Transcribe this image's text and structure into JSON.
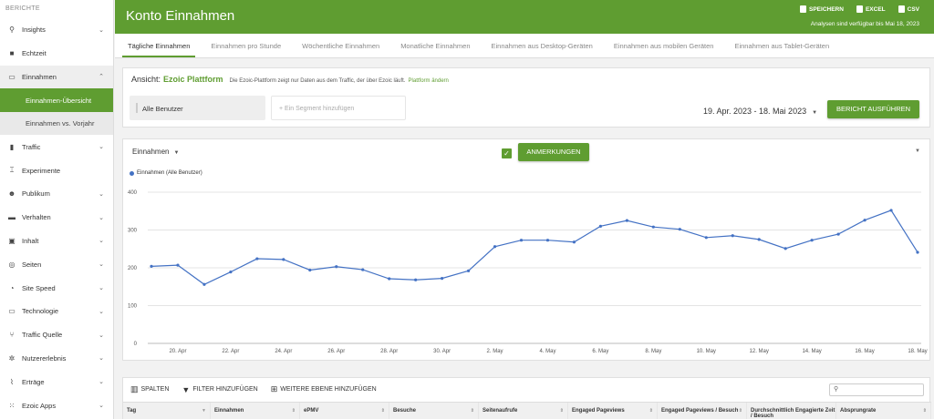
{
  "sidebar": {
    "heading": "BERICHTE",
    "items": [
      {
        "label": "Insights",
        "icon": "search-icon",
        "glyph": "⚲",
        "chevron": "⌄"
      },
      {
        "label": "Echtzeit",
        "icon": "video-icon",
        "glyph": "■",
        "chevron": ""
      },
      {
        "label": "Einnahmen",
        "icon": "money-icon",
        "glyph": "▭",
        "chevron": "⌃"
      },
      {
        "label": "Traffic",
        "icon": "traffic-icon",
        "glyph": "▮",
        "chevron": "⌄"
      },
      {
        "label": "Experimente",
        "icon": "flask-icon",
        "glyph": "⌶",
        "chevron": ""
      },
      {
        "label": "Publikum",
        "icon": "people-icon",
        "glyph": "☻",
        "chevron": "⌄"
      },
      {
        "label": "Verhalten",
        "icon": "behavior-icon",
        "glyph": "▬",
        "chevron": "⌄"
      },
      {
        "label": "Inhalt",
        "icon": "content-icon",
        "glyph": "▣",
        "chevron": "⌄"
      },
      {
        "label": "Seiten",
        "icon": "globe-icon",
        "glyph": "◎",
        "chevron": "⌄"
      },
      {
        "label": "Site Speed",
        "icon": "speedometer-icon",
        "glyph": "◔",
        "chevron": "⌄"
      },
      {
        "label": "Technologie",
        "icon": "monitor-icon",
        "glyph": "▭",
        "chevron": "⌄"
      },
      {
        "label": "Traffic Quelle",
        "icon": "source-icon",
        "glyph": "⑂",
        "chevron": "⌄"
      },
      {
        "label": "Nutzererlebnis",
        "icon": "gear-icon",
        "glyph": "✲",
        "chevron": "⌄"
      },
      {
        "label": "Erträge",
        "icon": "chart-icon",
        "glyph": "⌇",
        "chevron": "⌄"
      },
      {
        "label": "Ezoic Apps",
        "icon": "apps-icon",
        "glyph": "⁙",
        "chevron": "⌄"
      }
    ],
    "subitems": [
      {
        "label": "Einnahmen-Übersicht",
        "active": true
      },
      {
        "label": "Einnahmen vs. Vorjahr",
        "active": false
      }
    ]
  },
  "header": {
    "title": "Konto Einnahmen",
    "save": "SPEICHERN",
    "excel": "EXCEL",
    "csv": "CSV",
    "availability": "Analysen sind verfügbar bis Mai 18, 2023"
  },
  "tabs": [
    "Tägliche Einnahmen",
    "Einnahmen pro Stunde",
    "Wöchentliche Einnahmen",
    "Monatliche Einnahmen",
    "Einnahmen aus Desktop-Geräten",
    "Einnahmen aus mobilen Geräten",
    "Einnahmen aus Tablet-Geräten"
  ],
  "view": {
    "label": "Ansicht:",
    "brand": "Ezoic Plattform",
    "description": "Die Ezoic-Plattform zeigt nur Daten aus dem Traffic, der über Ezoic läuft.",
    "change_link": "Plattform ändern",
    "segment_all": "Alle Benutzer",
    "segment_placeholder": "+ Ein Segment hinzufügen",
    "date_range": "19. Apr. 2023 - 18. Mai 2023",
    "run_button": "BERICHT AUSFÜHREN"
  },
  "chart_controls": {
    "metric": "Einnahmen",
    "annotations_button": "ANMERKUNGEN",
    "annotations_checked": true
  },
  "chart_data": {
    "type": "line",
    "legend": [
      "Einnahmen (Alle Benutzer)"
    ],
    "color": "#4472c4",
    "ylim": [
      0,
      400
    ],
    "yticks": [
      0,
      100,
      200,
      300,
      400
    ],
    "xticklabels": [
      "20. Apr",
      "22. Apr",
      "24. Apr",
      "26. Apr",
      "28. Apr",
      "30. Apr",
      "2. May",
      "4. May",
      "6. May",
      "8. May",
      "10. May",
      "12. May",
      "14. May",
      "16. May",
      "18. May"
    ],
    "x": [
      "19. Apr",
      "20. Apr",
      "21. Apr",
      "22. Apr",
      "23. Apr",
      "24. Apr",
      "25. Apr",
      "26. Apr",
      "27. Apr",
      "28. Apr",
      "29. Apr",
      "30. Apr",
      "1. May",
      "2. May",
      "3. May",
      "4. May",
      "5. May",
      "6. May",
      "7. May",
      "8. May",
      "9. May",
      "10. May",
      "11. May",
      "12. May",
      "13. May",
      "14. May",
      "15. May",
      "16. May",
      "17. May",
      "18. May"
    ],
    "series": [
      {
        "name": "Einnahmen (Alle Benutzer)",
        "values": [
          204,
          207,
          156,
          189,
          224,
          222,
          194,
          203,
          195,
          171,
          168,
          172,
          192,
          256,
          273,
          273,
          268,
          310,
          325,
          308,
          302,
          280,
          285,
          275,
          251,
          273,
          289,
          326,
          352,
          241
        ]
      }
    ],
    "grid": true
  },
  "table": {
    "tools": [
      {
        "label": "SPALTEN",
        "icon": "columns-icon",
        "glyph": "▥"
      },
      {
        "label": "FILTER HINZUFÜGEN",
        "icon": "filter-icon",
        "glyph": "▼"
      },
      {
        "label": "WEITERE EBENE HINZUFÜGEN",
        "icon": "add-level-icon",
        "glyph": "⊞"
      }
    ],
    "columns": [
      {
        "label": "Tag",
        "w": 96
      },
      {
        "label": "Einnahmen",
        "w": 98
      },
      {
        "label": "ePMV",
        "w": 98
      },
      {
        "label": "Besuche",
        "w": 98
      },
      {
        "label": "Seitenaufrufe",
        "w": 98
      },
      {
        "label": "Engaged Pageviews",
        "w": 98
      },
      {
        "label": "Engaged Pageviews / Besuch",
        "w": 98
      },
      {
        "label": "Durchschnittlich Engagierte Zeit / Besuch",
        "w": 98
      },
      {
        "label": "Absprungrate",
        "w": 104
      }
    ]
  }
}
